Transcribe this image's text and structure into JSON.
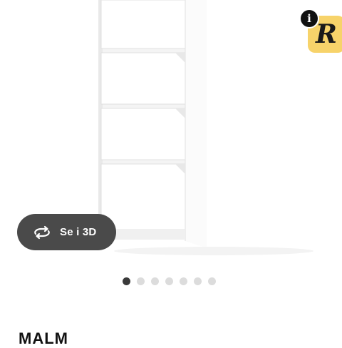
{
  "badge": {
    "info_label": "i",
    "letter": "R",
    "accent": "#f7d36a"
  },
  "view_3d": {
    "label": "Se i 3D",
    "icon": "rotate-360-icon"
  },
  "carousel": {
    "total": 7,
    "active_index": 0
  },
  "product": {
    "name": "MALM"
  }
}
